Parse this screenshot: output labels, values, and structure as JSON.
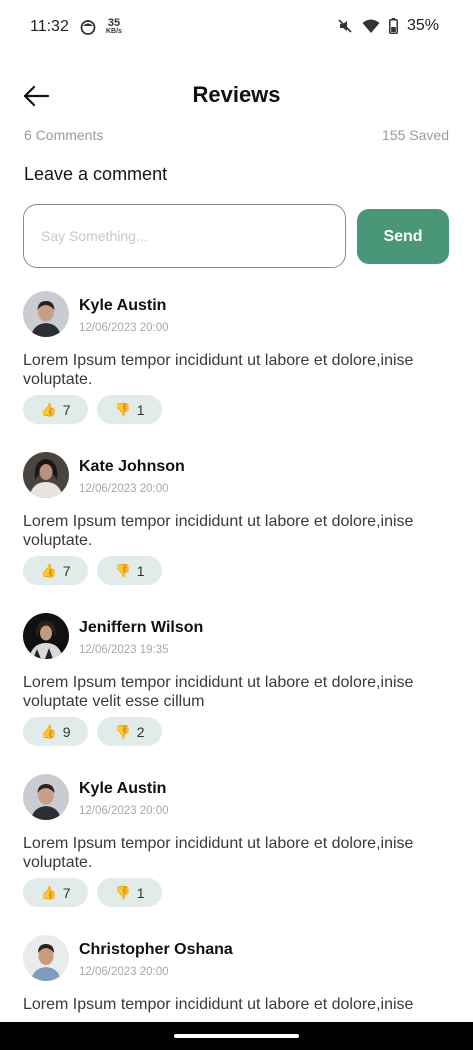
{
  "status_bar": {
    "time": "11:32",
    "net_speed_value": "35",
    "net_speed_unit": "KB/s",
    "battery_percent": "35%"
  },
  "header": {
    "title": "Reviews"
  },
  "meta": {
    "comments_count": "6 Comments",
    "saved_count": "155 Saved"
  },
  "compose": {
    "label": "Leave a comment",
    "placeholder": "Say Something...",
    "value": "",
    "send_label": "Send"
  },
  "comments": [
    {
      "author": "Kyle Austin",
      "date": "12/06/2023 20:00",
      "text": "Lorem Ipsum tempor incididunt ut labore et dolore,inise voluptate.",
      "likes": "7",
      "dislikes": "1",
      "like_emoji": "👍",
      "dislike_emoji": "👎"
    },
    {
      "author": "Kate Johnson",
      "date": "12/06/2023 20:00",
      "text": "Lorem Ipsum tempor incididunt ut labore et dolore,inise voluptate.",
      "likes": "7",
      "dislikes": "1",
      "like_emoji": "👍",
      "dislike_emoji": "👎"
    },
    {
      "author": "Jeniffern Wilson",
      "date": "12/06/2023 19:35",
      "text": "Lorem Ipsum tempor incididunt ut labore et dolore,inise voluptate velit esse cillum",
      "likes": "9",
      "dislikes": "2",
      "like_emoji": "👍",
      "dislike_emoji": "👎"
    },
    {
      "author": "Kyle Austin",
      "date": "12/06/2023 20:00",
      "text": "Lorem Ipsum tempor incididunt ut labore et dolore,inise voluptate.",
      "likes": "7",
      "dislikes": "1",
      "like_emoji": "👍",
      "dislike_emoji": "👎"
    },
    {
      "author": "Christopher Oshana",
      "date": "12/06/2023 20:00",
      "text": "Lorem Ipsum tempor incididunt ut labore et dolore,inise"
    }
  ],
  "colors": {
    "accent": "#4a9679",
    "reaction_bg": "#e1ecea",
    "muted_text": "#9a9a9a"
  }
}
